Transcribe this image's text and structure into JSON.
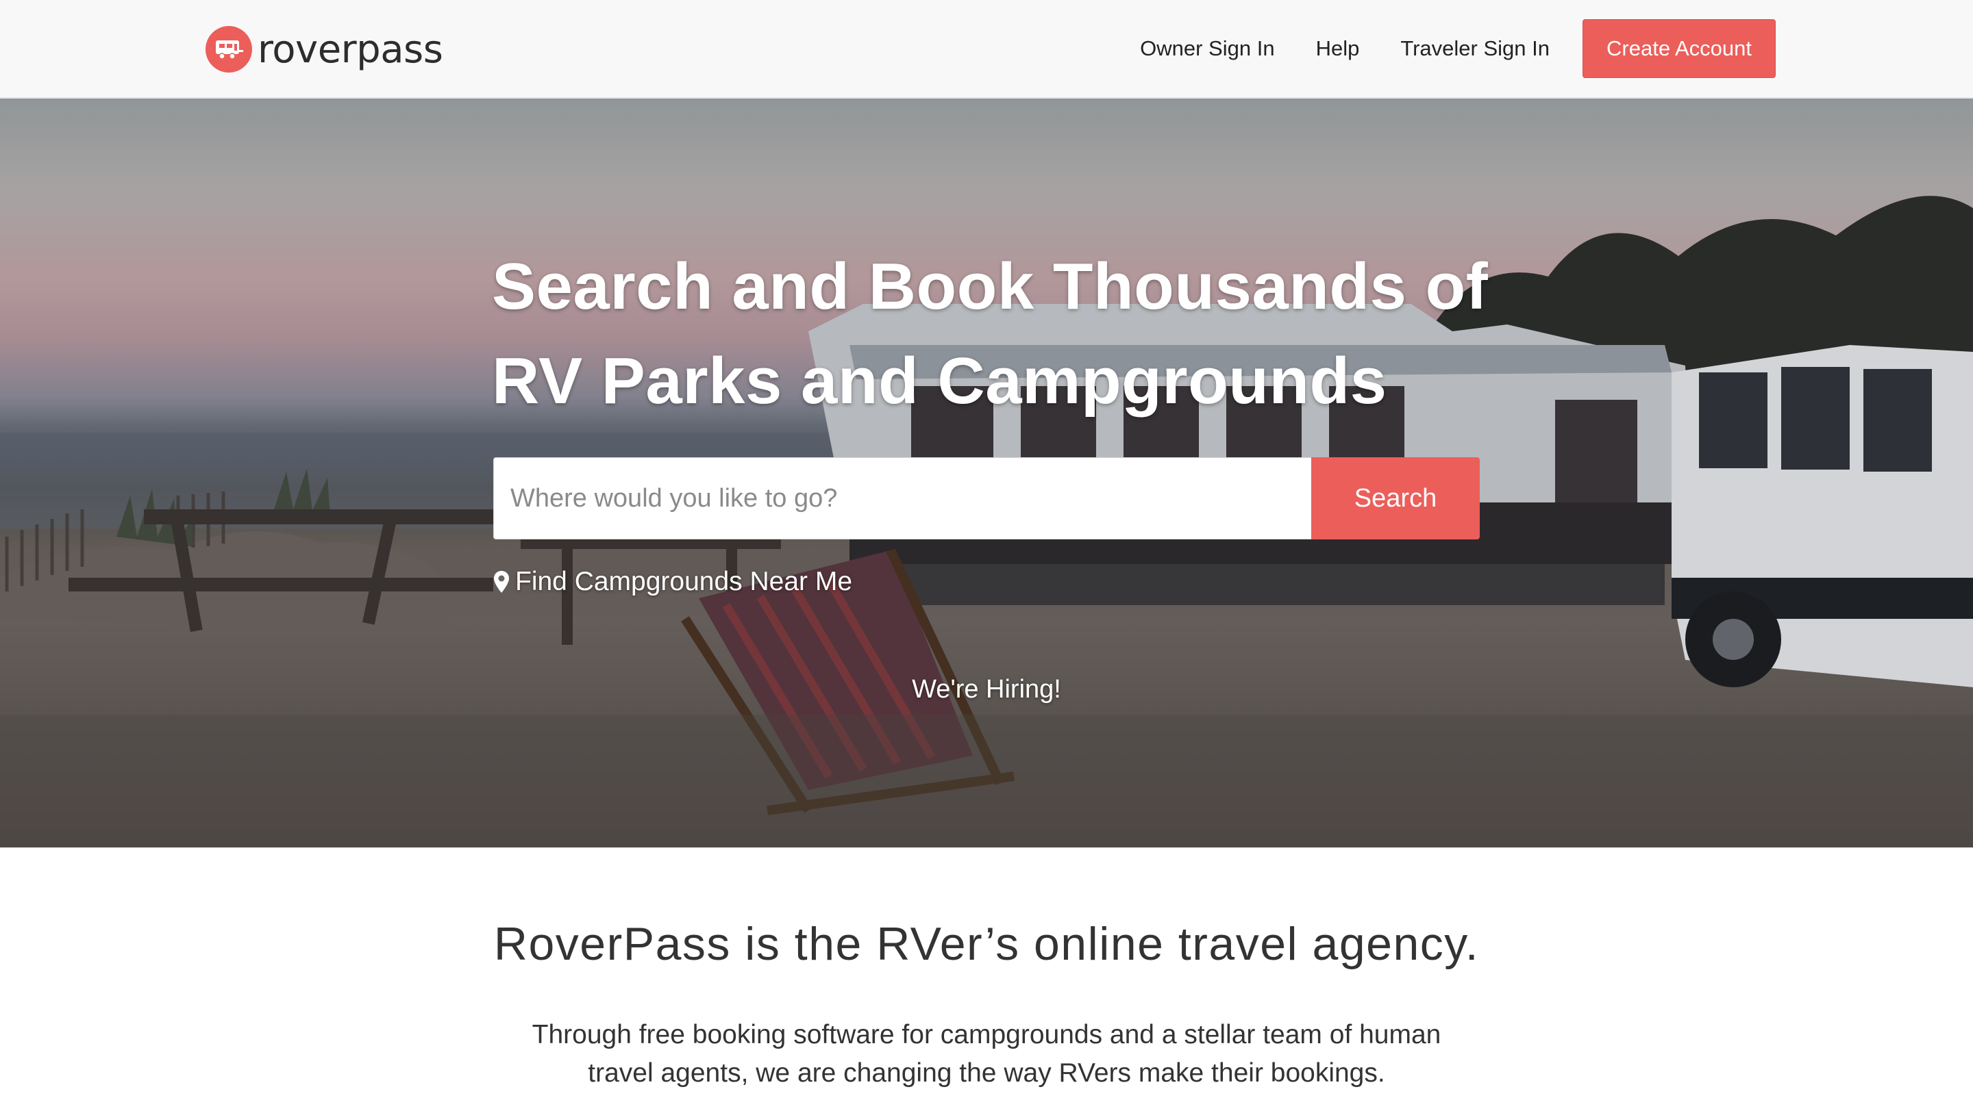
{
  "header": {
    "logo_text": "roverpass",
    "nav": {
      "owner_sign_in": "Owner Sign In",
      "help": "Help",
      "traveler_sign_in": "Traveler Sign In",
      "create_account": "Create Account"
    },
    "accent_color": "#ec5e5a"
  },
  "hero": {
    "title_line1": "Search and Book Thousands of",
    "title_line2": "RV Parks and Campgrounds",
    "search_placeholder": "Where would you like to go?",
    "search_value": "",
    "search_button": "Search",
    "near_me_icon": "map-pin-icon",
    "near_me_label": "Find Campgrounds Near Me",
    "hiring_link": "We're Hiring!"
  },
  "about": {
    "title": "RoverPass is the RVer’s online travel agency.",
    "text_line1": "Through free booking software for campgrounds and a stellar team of human",
    "text_line2": "travel agents, we are changing the way RVers make their bookings."
  }
}
